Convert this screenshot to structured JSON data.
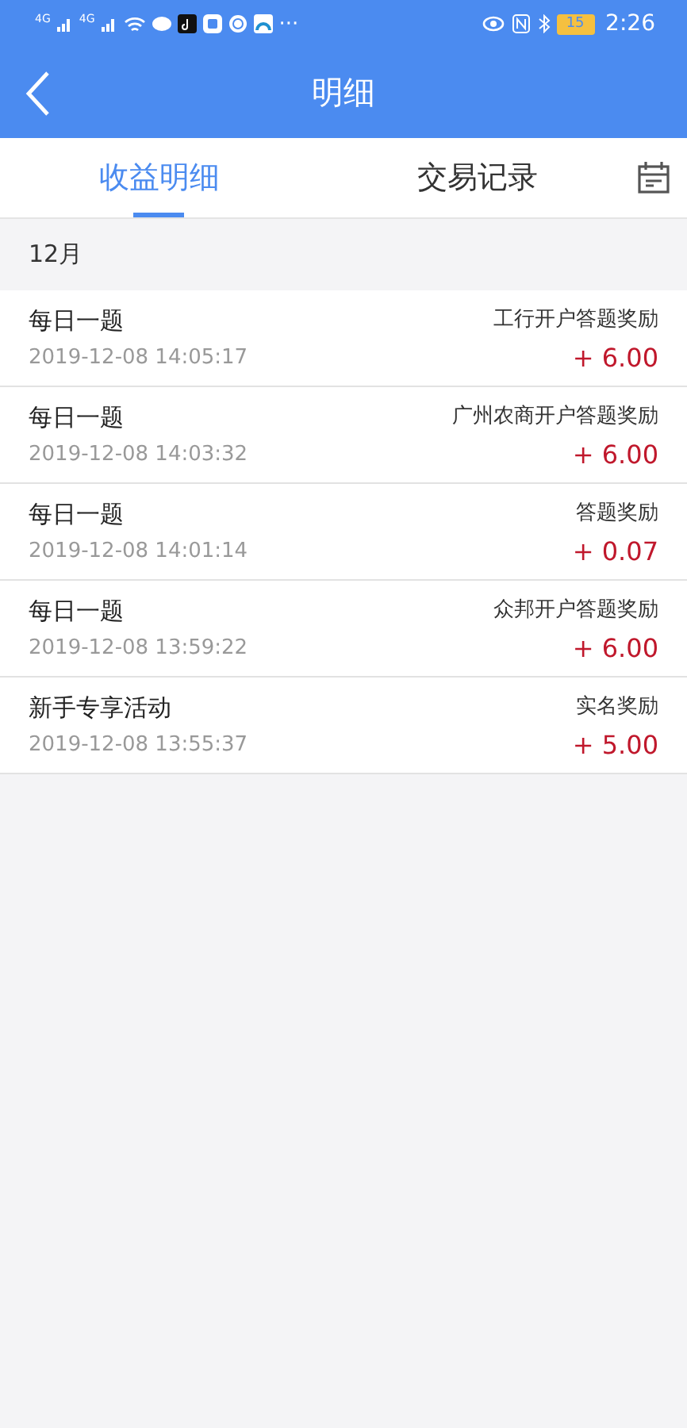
{
  "status_bar": {
    "network_1": "4G",
    "network_2": "4G",
    "more": "···",
    "battery": "15",
    "time": "2:26"
  },
  "header": {
    "title": "明细"
  },
  "tabs": [
    {
      "label": "收益明细",
      "selected": true
    },
    {
      "label": "交易记录",
      "selected": false
    }
  ],
  "month": "12月",
  "records": [
    {
      "title": "每日一题",
      "time": "2019-12-08 14:05:17",
      "description": "工行开户答题奖励",
      "amount": "+ 6.00"
    },
    {
      "title": "每日一题",
      "time": "2019-12-08 14:03:32",
      "description": "广州农商开户答题奖励",
      "amount": "+ 6.00"
    },
    {
      "title": "每日一题",
      "time": "2019-12-08 14:01:14",
      "description": "答题奖励",
      "amount": "+ 0.07"
    },
    {
      "title": "每日一题",
      "time": "2019-12-08 13:59:22",
      "description": "众邦开户答题奖励",
      "amount": "+ 6.00"
    },
    {
      "title": "新手专享活动",
      "time": "2019-12-08 13:55:37",
      "description": "实名奖励",
      "amount": "+ 5.00"
    }
  ]
}
